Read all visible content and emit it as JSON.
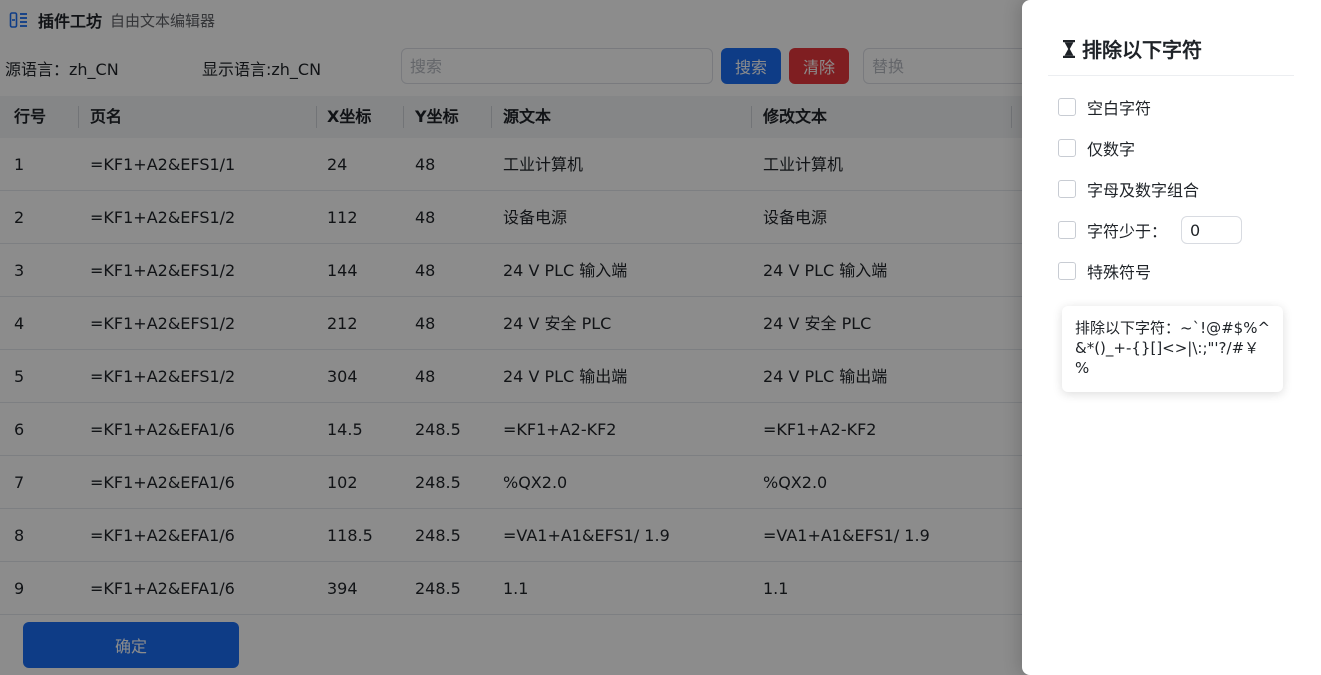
{
  "header": {
    "app_name": "插件工坊",
    "app_subtitle": "自由文本编辑器",
    "app_icon": "text-columns-icon"
  },
  "toolbar": {
    "source_lang": "源语言：zh_CN",
    "display_lang": "显示语言:zh_CN",
    "search_placeholder": "搜索",
    "search_label": "搜索",
    "clear_label": "清除",
    "replace_placeholder": "替换"
  },
  "table": {
    "columns": [
      "行号",
      "页名",
      "X坐标",
      "Y坐标",
      "源文本",
      "修改文本"
    ],
    "rows": [
      [
        "1",
        "=KF1+A2&EFS1/1",
        "24",
        "48",
        "工业计算机",
        "工业计算机"
      ],
      [
        "2",
        "=KF1+A2&EFS1/2",
        "112",
        "48",
        "设备电源",
        "设备电源"
      ],
      [
        "3",
        "=KF1+A2&EFS1/2",
        "144",
        "48",
        "24 V PLC 输入端",
        "24 V PLC 输入端"
      ],
      [
        "4",
        "=KF1+A2&EFS1/2",
        "212",
        "48",
        "24 V 安全 PLC",
        "24 V 安全 PLC"
      ],
      [
        "5",
        "=KF1+A2&EFS1/2",
        "304",
        "48",
        "24 V PLC 输出端",
        "24 V PLC 输出端"
      ],
      [
        "6",
        "=KF1+A2&EFA1/6",
        "14.5",
        "248.5",
        "=KF1+A2-KF2",
        "=KF1+A2-KF2"
      ],
      [
        "7",
        "=KF1+A2&EFA1/6",
        "102",
        "248.5",
        "%QX2.0",
        "%QX2.0"
      ],
      [
        "8",
        "=KF1+A2&EFA1/6",
        "118.5",
        "248.5",
        "=VA1+A1&EFS1/ 1.9",
        "=VA1+A1&EFS1/ 1.9"
      ],
      [
        "9",
        "=KF1+A2&EFA1/6",
        "394",
        "248.5",
        "1.1",
        "1.1"
      ]
    ]
  },
  "footer": {
    "ok_label": "确定"
  },
  "drawer": {
    "title": "排除以下字符",
    "title_icon": "hourglass-icon",
    "options": [
      {
        "label": "空白字符",
        "checked": false
      },
      {
        "label": "仅数字",
        "checked": false
      },
      {
        "label": "字母及数字组合",
        "checked": false
      },
      {
        "label": "字符少于：",
        "checked": false,
        "value": "0"
      },
      {
        "label": "特殊符号",
        "checked": false
      }
    ],
    "tooltip": "排除以下字符：~`!@#$%^&*()_+-{}[]<>|\\:;\"'?/#￥%"
  },
  "colors": {
    "primary": "#1a6ef5",
    "danger": "#e8383d",
    "overlay": "rgba(0,0,0,0.45)"
  }
}
